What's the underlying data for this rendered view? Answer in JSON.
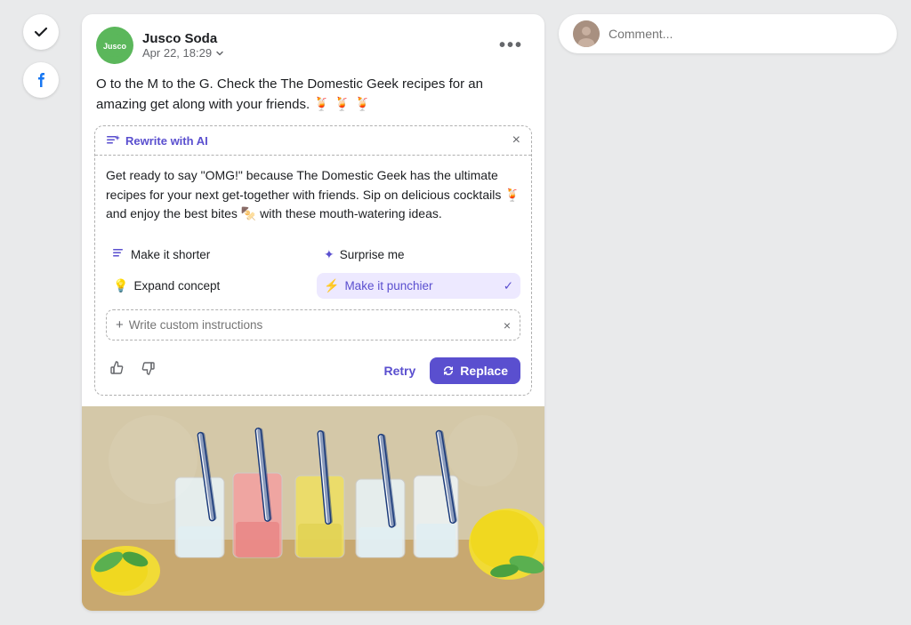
{
  "sidebar": {
    "check_icon": "✓",
    "facebook_icon": "f"
  },
  "post": {
    "author": "Jusco Soda",
    "avatar_initials": "Jusco",
    "timestamp": "Apr 22, 18:29",
    "menu_dots": "•••",
    "text": "O to the M to the G. Check the The Domestic Geek recipes for an amazing get along with your friends. 🍹 🍹 🍹",
    "ai_panel": {
      "title": "Rewrite with AI",
      "close": "×",
      "rewritten_text": "Get ready to say \"OMG!\" because The Domestic Geek has the ultimate recipes for your next get-together with friends. Sip on delicious cocktails 🍹 and enjoy the best bites 🍢 with these mouth-watering ideas.",
      "options": [
        {
          "id": "shorter",
          "icon": "≡",
          "label": "Make it shorter",
          "active": false
        },
        {
          "id": "surprise",
          "icon": "✦",
          "label": "Surprise me",
          "active": false
        },
        {
          "id": "expand",
          "icon": "💡",
          "label": "Expand concept",
          "active": false
        },
        {
          "id": "punchier",
          "icon": "⚡",
          "label": "Make it punchier",
          "active": true
        }
      ],
      "custom_placeholder": "Write custom instructions",
      "retry_label": "Retry",
      "replace_label": "Replace",
      "replace_icon": "↻"
    }
  },
  "comment": {
    "placeholder": "Comment..."
  }
}
